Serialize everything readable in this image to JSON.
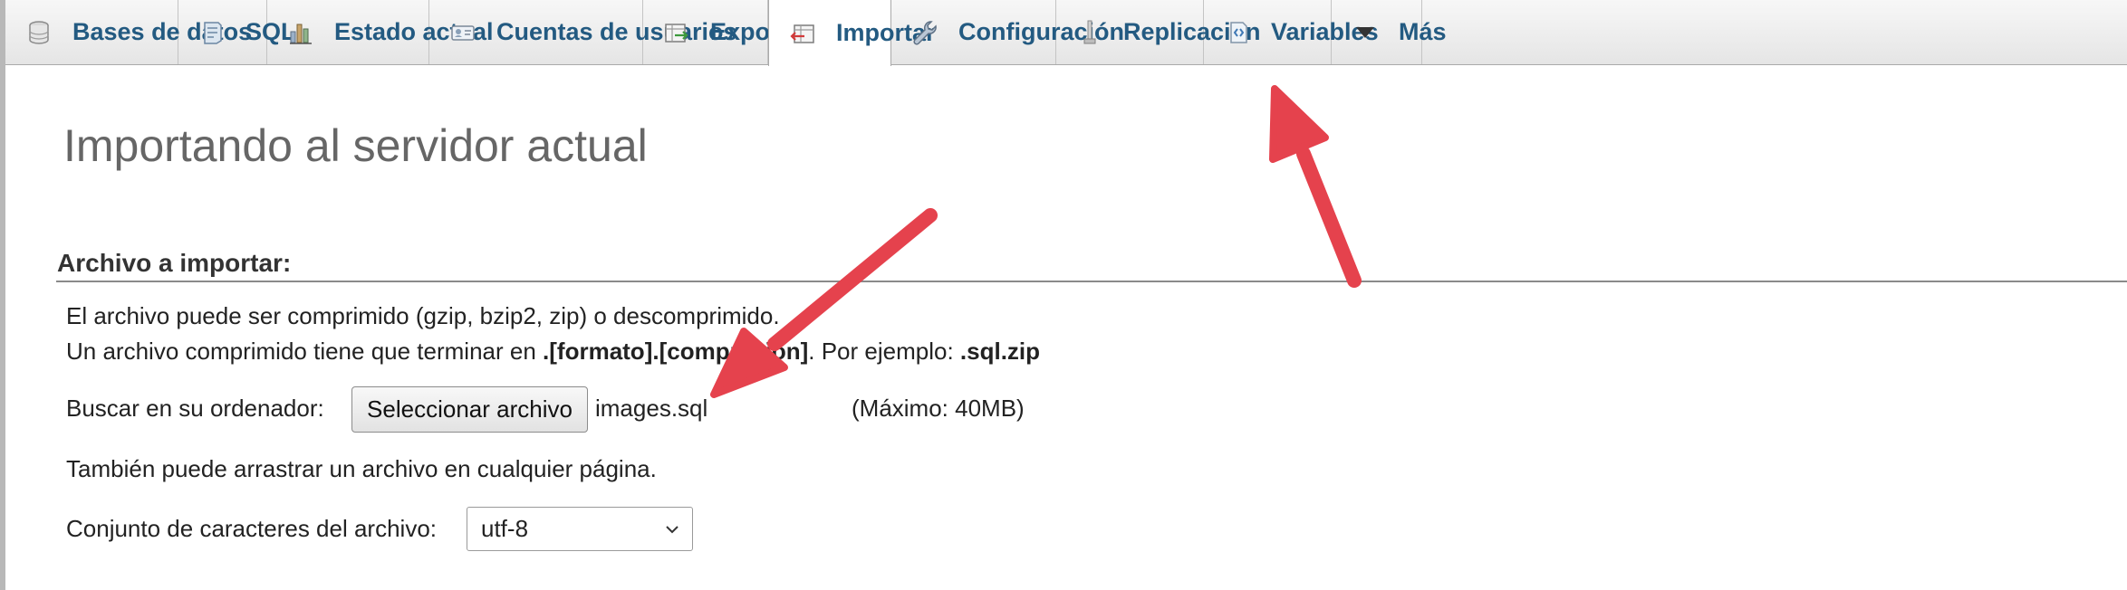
{
  "tabs": [
    {
      "label": "Bases de datos",
      "icon": "database-icon"
    },
    {
      "label": "SQL",
      "icon": "sql-icon"
    },
    {
      "label": "Estado actual",
      "icon": "status-chart-icon"
    },
    {
      "label": "Cuentas de usuarios",
      "icon": "user-accounts-icon"
    },
    {
      "label": "Exportar",
      "icon": "export-icon"
    },
    {
      "label": "Importar",
      "icon": "import-icon",
      "active": true
    },
    {
      "label": "Configuración",
      "icon": "wrench-icon"
    },
    {
      "label": "Replicación",
      "icon": "replication-icon"
    },
    {
      "label": "Variables",
      "icon": "variables-icon"
    },
    {
      "label": "Más",
      "icon": "triangle-down-icon"
    }
  ],
  "page": {
    "title": "Importando al servidor actual"
  },
  "import_file": {
    "legend": "Archivo a importar:",
    "line1": "El archivo puede ser comprimido (gzip, bzip2, zip) o descomprimido.",
    "line2_prefix": "Un archivo comprimido tiene que terminar en ",
    "line2_bold1": ".[formato].[compresión]",
    "line2_mid": ". Por ejemplo: ",
    "line2_bold2": ".sql.zip",
    "browse_label": "Buscar en su ordenador:",
    "browse_button": "Seleccionar archivo",
    "selected_file": "images.sql",
    "max_size": "(Máximo: 40MB)",
    "drag_hint": "También puede arrastrar un archivo en cualquier página.",
    "charset_label": "Conjunto de caracteres del archivo:",
    "charset_value": "utf-8"
  },
  "colors": {
    "tab_text": "#235a81",
    "title_text": "#666666",
    "annotation_arrow": "#e5424d"
  }
}
